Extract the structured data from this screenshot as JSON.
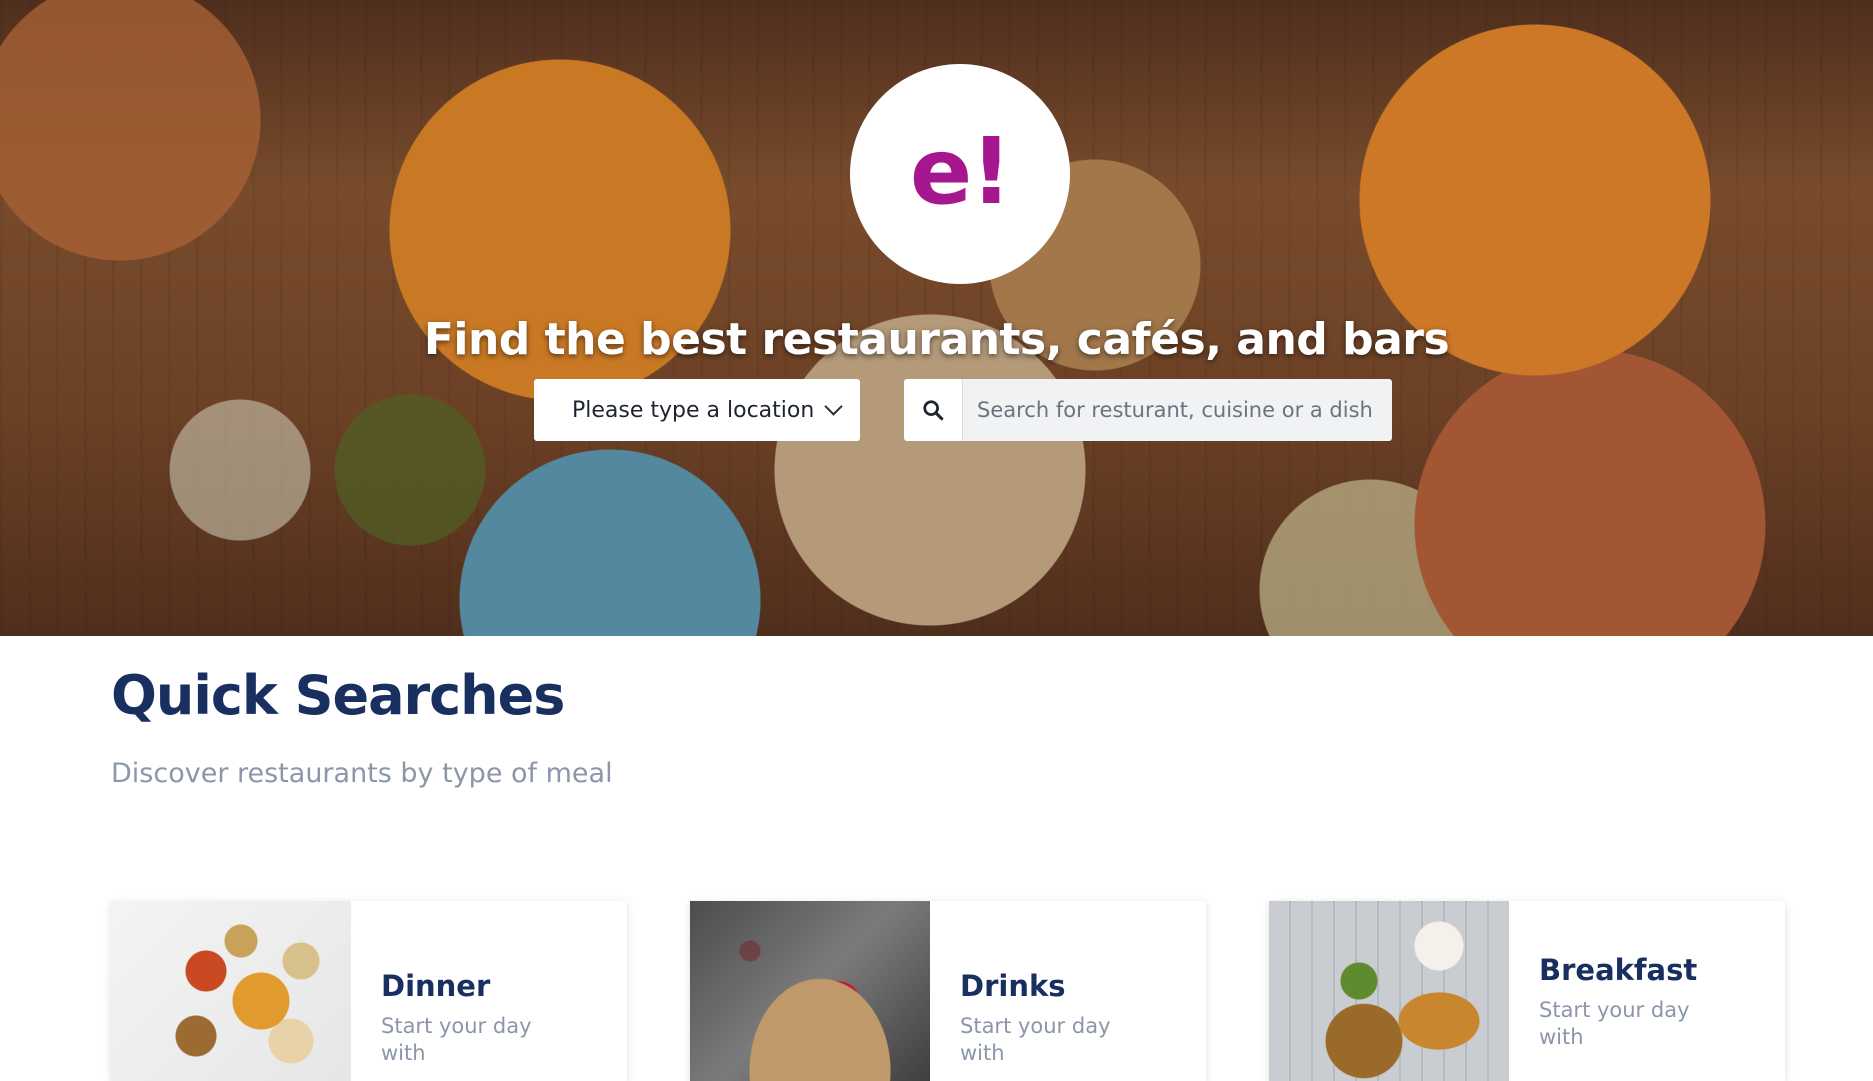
{
  "hero": {
    "logo_text": "e!",
    "title": "Find the best restaurants, cafés, and bars",
    "location_placeholder": "Please type a location",
    "search_placeholder": "Search for resturant, cuisine or a dish"
  },
  "quick_searches": {
    "title": "Quick Searches",
    "subtitle": "Discover restaurants by type of meal",
    "cards": [
      {
        "title": "Dinner",
        "description": "Start your day with"
      },
      {
        "title": "Drinks",
        "description": "Start your day with"
      },
      {
        "title": "Breakfast",
        "description": "Start your day with"
      }
    ]
  },
  "colors": {
    "brand": "#a6178f",
    "heading": "#192f60",
    "muted": "#8c96a9"
  },
  "icons": {
    "search": "search-icon",
    "chevron": "chevron-down-icon"
  }
}
